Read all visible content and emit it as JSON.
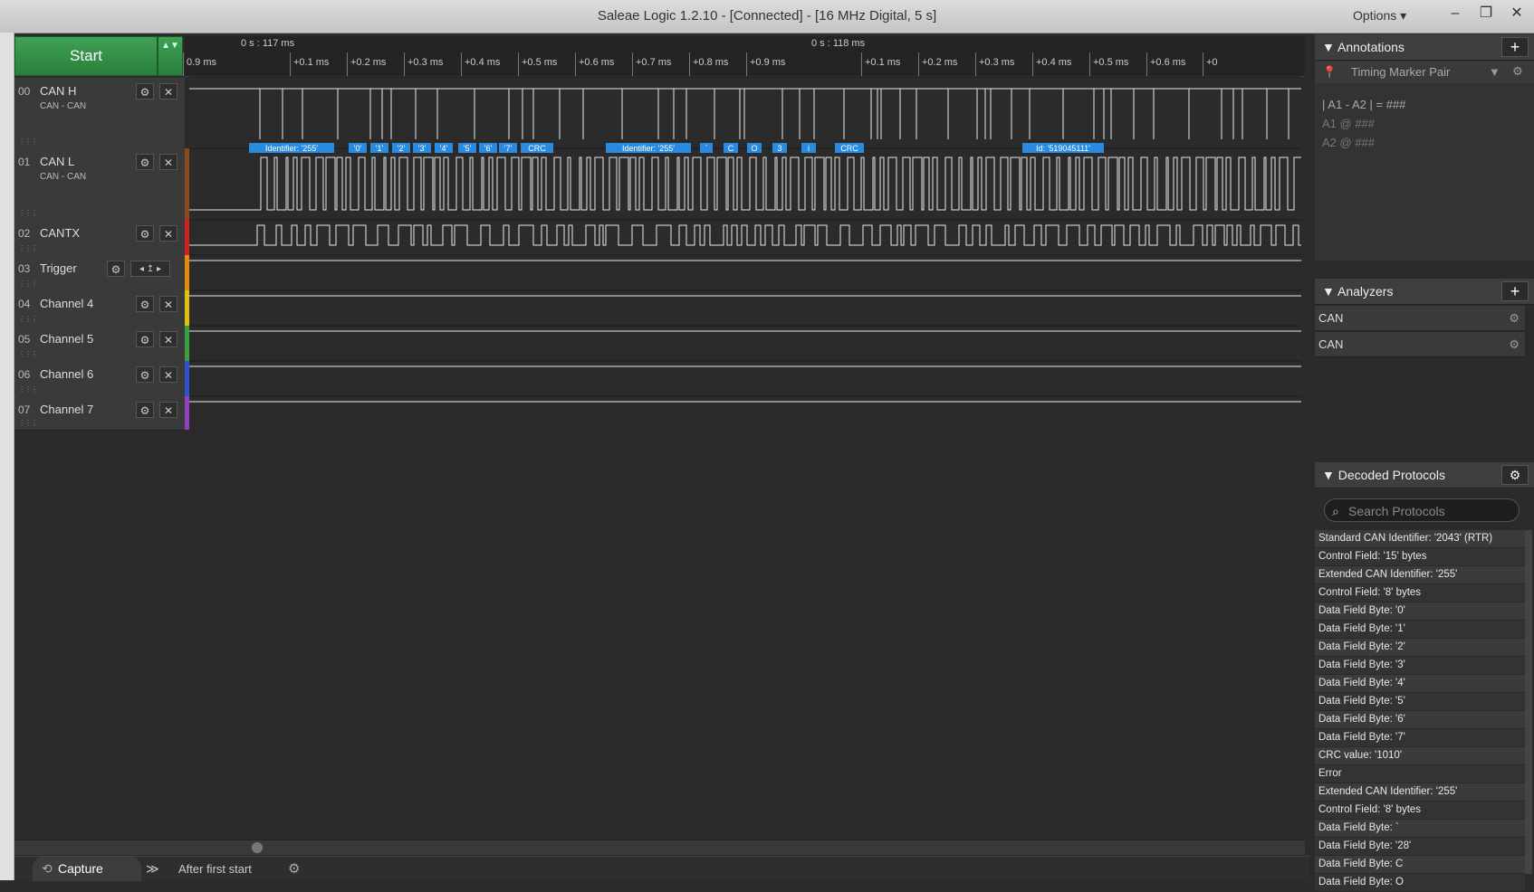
{
  "window": {
    "title": "Saleae Logic 1.2.10 - [Connected] - [16 MHz Digital, 5 s]",
    "options_label": "Options ▾",
    "minimize": "–",
    "restore": "❐",
    "close": "✕"
  },
  "toolbar": {
    "start_label": "Start",
    "start_arrows": "▲▼"
  },
  "ruler": {
    "top_labels": [
      "0 s : 117 ms",
      "0 s : 118 ms"
    ],
    "bottom_labels": [
      "0.9 ms",
      "+0.1 ms",
      "+0.2 ms",
      "+0.3 ms",
      "+0.4 ms",
      "+0.5 ms",
      "+0.6 ms",
      "+0.7 ms",
      "+0.8 ms",
      "+0.9 ms",
      "+0.1 ms",
      "+0.2 ms",
      "+0.3 ms",
      "+0.4 ms",
      "+0.5 ms",
      "+0.6 ms",
      "+0"
    ]
  },
  "channels": [
    {
      "num": "00",
      "name": "CAN H",
      "sub": "CAN - CAN",
      "color": "#2a2a2a"
    },
    {
      "num": "01",
      "name": "CAN L",
      "sub": "CAN - CAN",
      "color": "#8a4a1a"
    },
    {
      "num": "02",
      "name": "CANTX",
      "sub": "",
      "color": "#d02020"
    },
    {
      "num": "03",
      "name": "Trigger",
      "sub": "",
      "color": "#e08a10"
    },
    {
      "num": "04",
      "name": "Channel 4",
      "sub": "",
      "color": "#e0c010"
    },
    {
      "num": "05",
      "name": "Channel 5",
      "sub": "",
      "color": "#3aa040"
    },
    {
      "num": "06",
      "name": "Channel 6",
      "sub": "",
      "color": "#3050d0"
    },
    {
      "num": "07",
      "name": "Channel 7",
      "sub": "",
      "color": "#9040c0"
    }
  ],
  "decode_bubbles": [
    "Identifier: '255'",
    "'0'",
    "'1'",
    "'2'",
    "'3'",
    "'4'",
    "'5'",
    "'6'",
    "'7'",
    "CRC",
    "Identifier: '255'",
    "`",
    "C",
    "O",
    "3",
    "i",
    "CRC",
    "Id: '519045111'"
  ],
  "annotations": {
    "header": "Annotations",
    "marker_pair": "Timing Marker Pair",
    "line1": "| A1 - A2 | = ###",
    "line2": "A1 @ ###",
    "line3": "A2 @ ###"
  },
  "analyzers": {
    "header": "Analyzers",
    "items": [
      "CAN",
      "CAN"
    ]
  },
  "decoded": {
    "header": "Decoded Protocols",
    "search_placeholder": "Search Protocols",
    "items": [
      "Standard CAN Identifier: '2043' (RTR)",
      "Control Field: '15' bytes",
      "Extended CAN Identifier: '255'",
      "Control Field: '8' bytes",
      "Data Field Byte: '0'",
      "Data Field Byte: '1'",
      "Data Field Byte: '2'",
      "Data Field Byte: '3'",
      "Data Field Byte: '4'",
      "Data Field Byte: '5'",
      "Data Field Byte: '6'",
      "Data Field Byte: '7'",
      "CRC value: '1010'",
      "Error",
      "Extended CAN Identifier: '255'",
      "Control Field: '8' bytes",
      "Data Field Byte: `",
      "Data Field Byte: '28'",
      "Data Field Byte: C",
      "Data Field Byte: O"
    ]
  },
  "bottom": {
    "capture_label": "Capture",
    "forward": "≫",
    "trigger_mode": "After first start"
  },
  "colors": {
    "accent_green": "#2a7f3c",
    "bubble_blue": "#2a8ae0"
  }
}
